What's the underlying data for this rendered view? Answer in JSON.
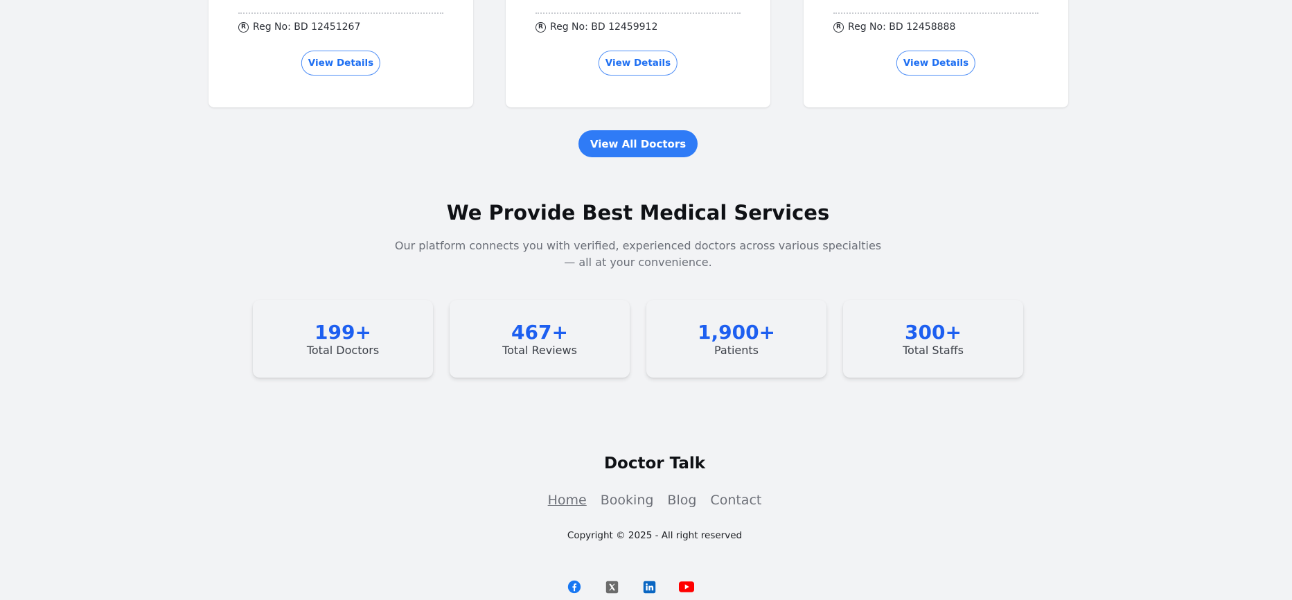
{
  "doctors": [
    {
      "reg_text": "Reg No: BD 12451267",
      "details_label": "View Details"
    },
    {
      "reg_text": "Reg No: BD 12459912",
      "details_label": "View Details"
    },
    {
      "reg_text": "Reg No: BD 12458888",
      "details_label": "View Details"
    }
  ],
  "reg_icon_glyph": "R",
  "view_all_label": "View All Doctors",
  "services": {
    "title": "We Provide Best Medical Services",
    "subtitle": "Our platform connects you with verified, experienced doctors across various specialties — all at your convenience."
  },
  "stats": [
    {
      "value": "199+",
      "label": "Total Doctors"
    },
    {
      "value": "467+",
      "label": "Total Reviews"
    },
    {
      "value": "1,900+",
      "label": "Patients"
    },
    {
      "value": "300+",
      "label": "Total Staffs"
    }
  ],
  "footer": {
    "brand": "Doctor Talk",
    "nav": [
      "Home",
      "Booking",
      "Blog",
      "Contact"
    ],
    "active_nav": "Home",
    "copyright": "Copyright © 2025 - All right reserved",
    "social": [
      {
        "icon": "facebook-icon",
        "color": "#1877f2"
      },
      {
        "icon": "x-twitter-icon",
        "color": "#6b6b6b"
      },
      {
        "icon": "linkedin-icon",
        "color": "#0a66c2"
      },
      {
        "icon": "youtube-icon",
        "color": "#ff0000"
      }
    ]
  },
  "colors": {
    "accent": "#2f7bf6",
    "stat_number": "#1d5ff0",
    "background": "#f2f3f5"
  }
}
